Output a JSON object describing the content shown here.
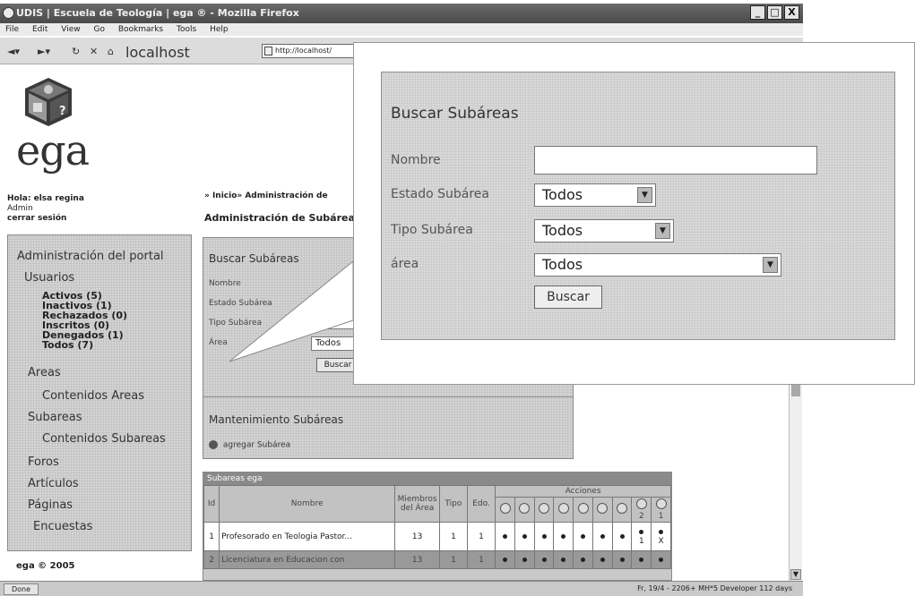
{
  "window": {
    "title": "UDIS | Escuela de Teología | ega ® - Mozilla Firefox",
    "buttons": [
      "_",
      "□",
      "X"
    ]
  },
  "menu": [
    "File",
    "Edit",
    "View",
    "Go",
    "Bookmarks",
    "Tools",
    "Help"
  ],
  "navbar": {
    "location_label": "localhost",
    "url": "http://localhost/"
  },
  "logo": {
    "text": "ega"
  },
  "user": {
    "greeting": "Hola: elsa regina",
    "role": "Admin",
    "logout": "cerrar sesión"
  },
  "breadcrumb": "» Inicio» Administración de",
  "section_title": "Administración de Subáreas",
  "sidebar": {
    "title": "Administración del portal",
    "usuarios": "Usuarios",
    "user_links": [
      "Activos (5)",
      "Inactivos (1)",
      "Rechazados (0)",
      "Inscritos (0)",
      "Denegados (1)",
      "Todos (7)"
    ],
    "areas": "Areas",
    "contenidos_areas": "Contenidos Areas",
    "subareas": "Subareas",
    "contenidos_subareas": "Contenidos Subareas",
    "foros": "Foros",
    "articulos": "Artículos",
    "paginas": "Páginas",
    "encuestas": "Encuestas"
  },
  "copyright": "ega © 2005",
  "search_panel": {
    "title": "Buscar Subáreas",
    "labels": [
      "Nombre",
      "Estado Subárea",
      "Tipo Subárea",
      "Área"
    ],
    "selects": [
      "Todos",
      "Todos",
      "Todos"
    ],
    "button": "Buscar"
  },
  "maint_panel": {
    "title": "Mantenimiento Subáreas",
    "add_link": "agregar Subárea"
  },
  "table": {
    "caption": "Subareas ega",
    "headers": [
      "Id",
      "Nombre",
      "Miembros del Área",
      "Tipo",
      "Edo.",
      "Acciones"
    ],
    "action_counts": [
      "2",
      "1"
    ],
    "rows": [
      {
        "id": "1",
        "nombre": "Profesorado en Teologia Pastor...",
        "miembros": "13",
        "tipo": "1",
        "edo": "1",
        "extra": [
          "1",
          "X"
        ]
      },
      {
        "id": "2",
        "nombre": "Licenciatura en Educacion con",
        "miembros": "13",
        "tipo": "1",
        "edo": "1",
        "extra": [
          "",
          ""
        ]
      }
    ]
  },
  "statusbar": {
    "status": "Done",
    "right": "Fr, 19/4 - 2206+ MH*5 Developer 112 days"
  },
  "zoom": {
    "title": "Buscar Subáreas",
    "labels": [
      "Nombre",
      "Estado Subárea",
      "Tipo Subárea",
      "área"
    ],
    "nombre_value": "",
    "selects": [
      "Todos",
      "Todos",
      "Todos"
    ],
    "button": "Buscar"
  }
}
